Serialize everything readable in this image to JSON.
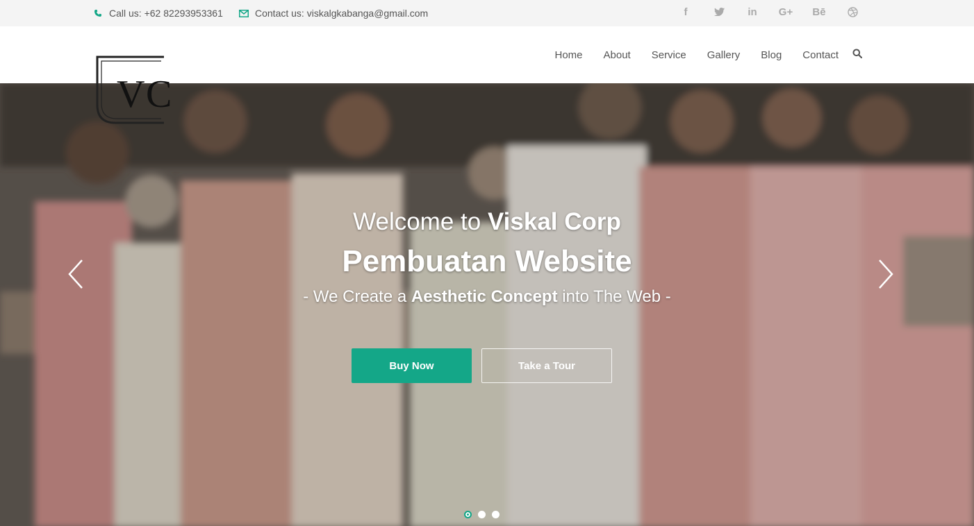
{
  "topbar": {
    "phone_text": "Call us: +62 82293953361",
    "email_text": "Contact us: viskalgkabanga@gmail.com",
    "accent": "#14a788",
    "social": [
      {
        "name": "facebook-icon",
        "glyph": "f"
      },
      {
        "name": "twitter-icon",
        "glyph": "t"
      },
      {
        "name": "linkedin-icon",
        "glyph": "in"
      },
      {
        "name": "google-plus-icon",
        "glyph": "G+"
      },
      {
        "name": "behance-icon",
        "glyph": "Bē"
      },
      {
        "name": "dribbble-icon",
        "glyph": "◎"
      }
    ]
  },
  "logo": {
    "text": "VC"
  },
  "nav": {
    "items": [
      "Home",
      "About",
      "Service",
      "Gallery",
      "Blog",
      "Contact"
    ]
  },
  "hero": {
    "welcome_prefix": "Welcome to",
    "welcome_brand": "Viskal Corp",
    "headline": "Pembuatan Website",
    "tagline_pre": "- We Create a",
    "tagline_bold": "Aesthetic Concept",
    "tagline_post": "into The Web -",
    "buy_label": "Buy Now",
    "tour_label": "Take a Tour",
    "slide_count": 3,
    "active_slide": 1
  }
}
